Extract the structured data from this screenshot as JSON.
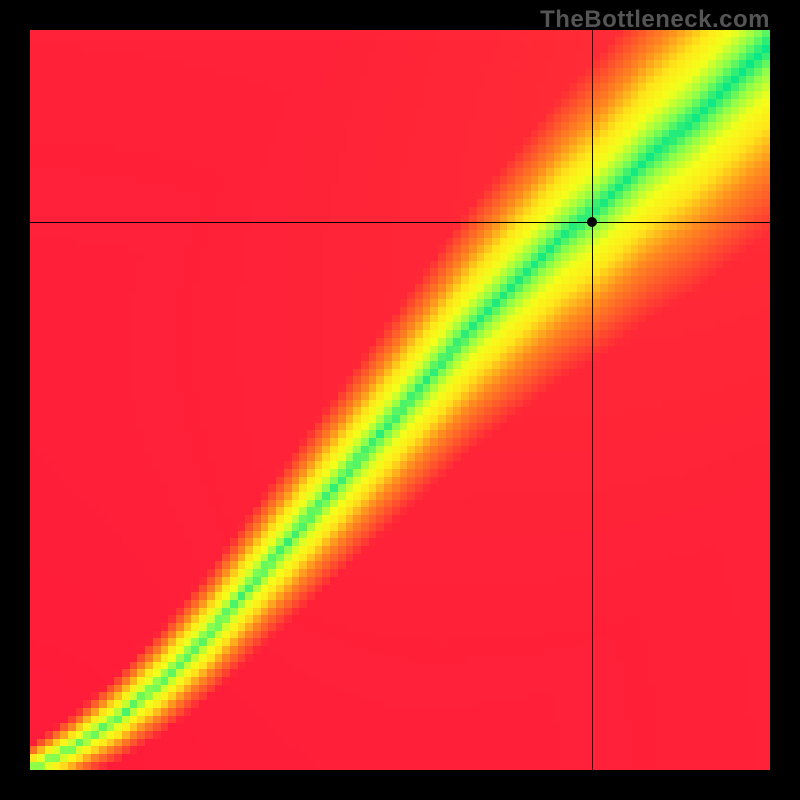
{
  "watermark": "TheBottleneck.com",
  "chart_data": {
    "type": "heatmap",
    "title": "",
    "xlabel": "",
    "ylabel": "",
    "xlim": [
      0,
      100
    ],
    "ylim": [
      0,
      100
    ],
    "grid": false,
    "legend": false,
    "crosshair": {
      "x": 76,
      "y": 74
    },
    "marker": {
      "x": 76,
      "y": 74
    },
    "ridge": {
      "description": "Green optimal band along a superlinear diagonal; red = bottleneck regions",
      "points_xy": [
        [
          0,
          0
        ],
        [
          6,
          3
        ],
        [
          12,
          7
        ],
        [
          18,
          12
        ],
        [
          24,
          18
        ],
        [
          30,
          25
        ],
        [
          36,
          32
        ],
        [
          42,
          39
        ],
        [
          48,
          46
        ],
        [
          54,
          53
        ],
        [
          60,
          60
        ],
        [
          66,
          66
        ],
        [
          72,
          72
        ],
        [
          78,
          77
        ],
        [
          84,
          83
        ],
        [
          90,
          88
        ],
        [
          96,
          94
        ],
        [
          100,
          98
        ]
      ],
      "band_width_start": 2,
      "band_width_end": 16
    },
    "color_stops": [
      {
        "t": 0.0,
        "hex": "#ff1a3a"
      },
      {
        "t": 0.35,
        "hex": "#ff8a1f"
      },
      {
        "t": 0.55,
        "hex": "#ffe71a"
      },
      {
        "t": 0.7,
        "hex": "#f4ff1a"
      },
      {
        "t": 0.85,
        "hex": "#8fff4a"
      },
      {
        "t": 1.0,
        "hex": "#00e58a"
      }
    ],
    "grid_resolution": 96
  }
}
